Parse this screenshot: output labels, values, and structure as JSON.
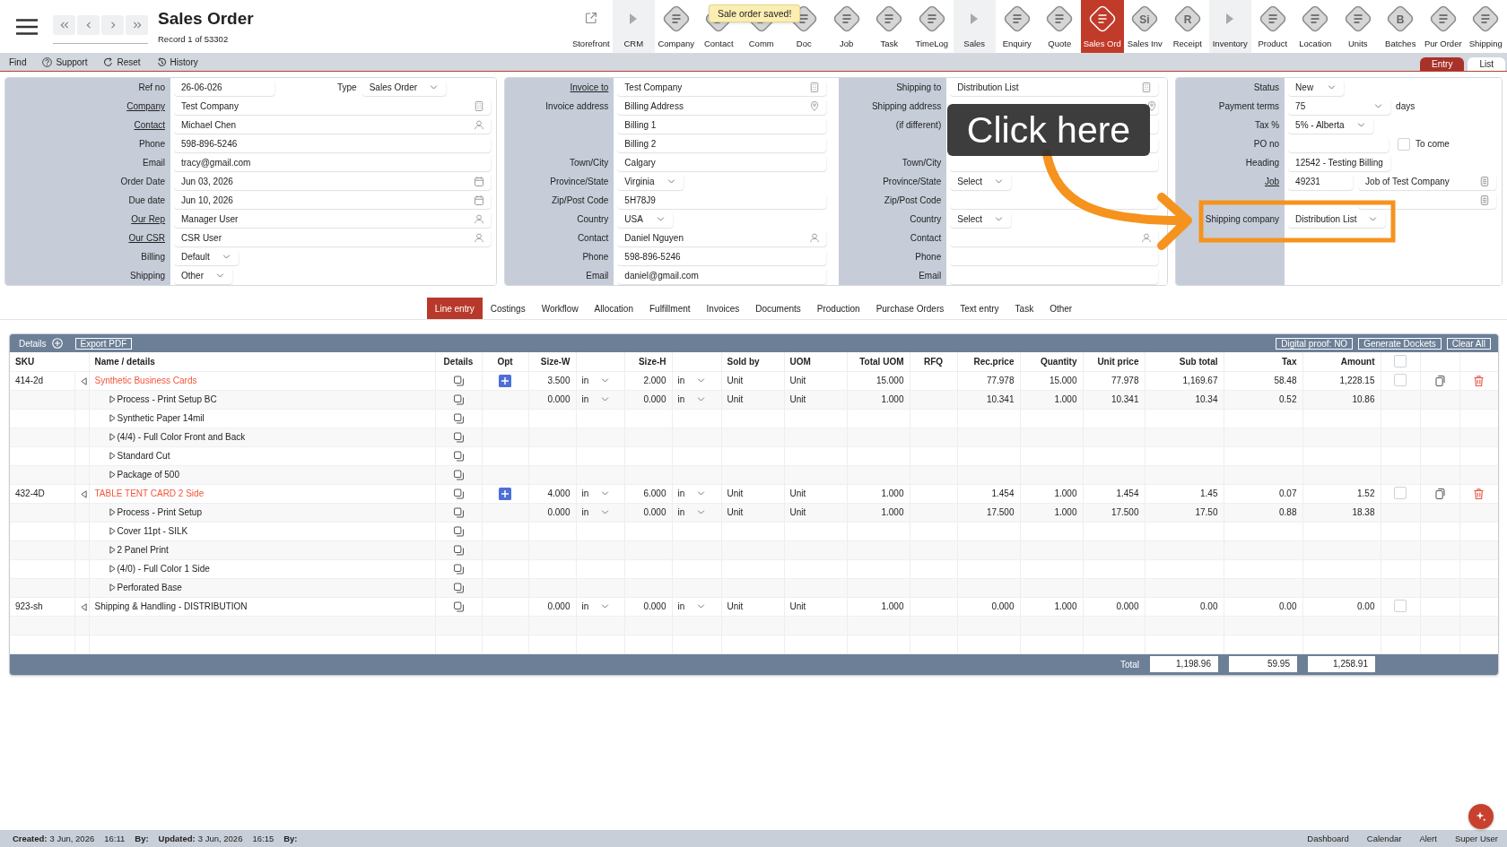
{
  "header": {
    "title": "Sales Order",
    "record": "Record 1 of 53302",
    "toast": "Sale order saved!",
    "toolbar": [
      {
        "label": "Storefront",
        "kind": "link",
        "selected": false
      },
      {
        "label": "CRM",
        "kind": "group",
        "selected": false
      },
      {
        "label": "Company",
        "kind": "module",
        "selected": false
      },
      {
        "label": "Contact",
        "kind": "module",
        "selected": false
      },
      {
        "label": "Comm",
        "kind": "module",
        "selected": false
      },
      {
        "label": "Doc",
        "kind": "module",
        "selected": false
      },
      {
        "label": "Job",
        "kind": "module",
        "selected": false
      },
      {
        "label": "Task",
        "kind": "module",
        "selected": false
      },
      {
        "label": "TimeLog",
        "kind": "module",
        "selected": false
      },
      {
        "label": "Sales",
        "kind": "group",
        "selected": false
      },
      {
        "label": "Enquiry",
        "kind": "module",
        "selected": false
      },
      {
        "label": "Quote",
        "kind": "module",
        "selected": false
      },
      {
        "label": "Sales Ord",
        "kind": "module",
        "selected": true
      },
      {
        "label": "Sales Inv",
        "kind": "module",
        "glyph": "Si",
        "selected": false
      },
      {
        "label": "Receipt",
        "kind": "module",
        "glyph": "R",
        "selected": false
      },
      {
        "label": "Inventory",
        "kind": "group",
        "selected": false
      },
      {
        "label": "Product",
        "kind": "module",
        "selected": false
      },
      {
        "label": "Location",
        "kind": "module",
        "selected": false
      },
      {
        "label": "Units",
        "kind": "module",
        "selected": false
      },
      {
        "label": "Batches",
        "kind": "module",
        "glyph": "B",
        "selected": false
      },
      {
        "label": "Pur Order",
        "kind": "module",
        "selected": false
      },
      {
        "label": "Shipping",
        "kind": "module",
        "selected": false
      }
    ]
  },
  "action_bar": {
    "actions": [
      {
        "label": "Find",
        "kind": "plain"
      },
      {
        "label": "Support",
        "kind": "help"
      },
      {
        "label": "Reset",
        "kind": "reset"
      },
      {
        "label": "History",
        "kind": "history"
      }
    ],
    "view_tabs": [
      {
        "label": "Entry",
        "selected": true
      },
      {
        "label": "List",
        "selected": false
      }
    ]
  },
  "form": {
    "panels": [
      {
        "sections": [
          {
            "rows": [
              {
                "label": "Ref no",
                "link": false,
                "fields": [
                  {
                    "kind": "text",
                    "value": "26-06-026"
                  },
                  {
                    "kind": "caption",
                    "value": "Type"
                  },
                  {
                    "kind": "select",
                    "value": "Sales Order"
                  }
                ]
              },
              {
                "label": "Company",
                "link": true,
                "fields": [
                  {
                    "kind": "company",
                    "value": "Test Company"
                  }
                ]
              },
              {
                "label": "Contact",
                "link": true,
                "fields": [
                  {
                    "kind": "contact",
                    "value": "Michael Chen"
                  }
                ]
              },
              {
                "label": "Phone",
                "link": false,
                "fields": [
                  {
                    "kind": "text",
                    "value": "598-896-5246"
                  }
                ]
              },
              {
                "label": "Email",
                "link": false,
                "fields": [
                  {
                    "kind": "text",
                    "value": "tracy@gmail.com"
                  }
                ]
              },
              {
                "label": "Order Date",
                "link": false,
                "fields": [
                  {
                    "kind": "date",
                    "value": "Jun 03, 2026"
                  }
                ]
              },
              {
                "label": "Due date",
                "link": false,
                "fields": [
                  {
                    "kind": "date",
                    "value": "Jun 10, 2026"
                  }
                ]
              },
              {
                "label": "Our Rep",
                "link": true,
                "fields": [
                  {
                    "kind": "contact",
                    "value": "Manager User"
                  }
                ]
              },
              {
                "label": "Our CSR",
                "link": true,
                "fields": [
                  {
                    "kind": "contact",
                    "value": "CSR User"
                  }
                ]
              },
              {
                "label": "Billing",
                "link": false,
                "fields": [
                  {
                    "kind": "select",
                    "value": "Default"
                  }
                ]
              },
              {
                "label": "Shipping",
                "link": false,
                "fields": [
                  {
                    "kind": "select",
                    "value": "Other"
                  }
                ]
              }
            ]
          }
        ]
      },
      {
        "sections": [
          {
            "rows": [
              {
                "label": "Invoice to",
                "link": true,
                "fields": [
                  {
                    "kind": "company",
                    "value": "Test Company"
                  }
                ]
              },
              {
                "label": "Invoice address",
                "link": false,
                "fields": [
                  {
                    "kind": "address",
                    "value": "Billing Address"
                  }
                ]
              },
              {
                "fields": [
                  {
                    "kind": "text",
                    "value": "Billing 1"
                  }
                ]
              },
              {
                "fields": [
                  {
                    "kind": "text",
                    "value": "Billing 2"
                  }
                ]
              },
              {
                "label": "Town/City",
                "link": false,
                "fields": [
                  {
                    "kind": "text",
                    "value": "Calgary"
                  }
                ]
              },
              {
                "label": "Province/State",
                "link": false,
                "fields": [
                  {
                    "kind": "select",
                    "value": "Virginia"
                  }
                ]
              },
              {
                "label": "Zip/Post Code",
                "link": false,
                "fields": [
                  {
                    "kind": "text",
                    "value": "5H78J9"
                  }
                ]
              },
              {
                "label": "Country",
                "link": false,
                "fields": [
                  {
                    "kind": "select",
                    "value": "USA"
                  }
                ]
              },
              {
                "label": "Contact",
                "link": false,
                "fields": [
                  {
                    "kind": "contact",
                    "value": "Daniel Nguyen"
                  }
                ]
              },
              {
                "label": "Phone",
                "link": false,
                "fields": [
                  {
                    "kind": "text",
                    "value": "598-896-5246"
                  }
                ]
              },
              {
                "label": "Email",
                "link": false,
                "fields": [
                  {
                    "kind": "text",
                    "value": "daniel@gmail.com"
                  }
                ]
              }
            ]
          },
          {
            "rows": [
              {
                "label": "Shipping to",
                "link": false,
                "fields": [
                  {
                    "kind": "company",
                    "value": "Distribution List"
                  }
                ]
              },
              {
                "label": "Shipping address",
                "link": false,
                "fields": [
                  {
                    "kind": "address"
                  }
                ]
              },
              {
                "label": "(if different)",
                "link": false,
                "fields": [
                  {
                    "kind": "text"
                  }
                ]
              },
              {
                "fields": [
                  {
                    "kind": "text"
                  }
                ]
              },
              {
                "label": "Town/City",
                "link": false,
                "fields": [
                  {
                    "kind": "text"
                  }
                ]
              },
              {
                "label": "Province/State",
                "link": false,
                "fields": [
                  {
                    "kind": "select",
                    "value": "Select"
                  }
                ]
              },
              {
                "label": "Zip/Post Code",
                "link": false,
                "fields": [
                  {
                    "kind": "text"
                  }
                ]
              },
              {
                "label": "Country",
                "link": false,
                "fields": [
                  {
                    "kind": "select",
                    "value": "Select"
                  }
                ]
              },
              {
                "label": "Contact",
                "link": false,
                "fields": [
                  {
                    "kind": "contact"
                  }
                ]
              },
              {
                "label": "Phone",
                "link": false,
                "fields": [
                  {
                    "kind": "text"
                  }
                ]
              },
              {
                "label": "Email",
                "link": false,
                "fields": [
                  {
                    "kind": "text"
                  }
                ]
              }
            ]
          }
        ]
      },
      {
        "sections": [
          {
            "rows": [
              {
                "label": "Status",
                "link": false,
                "fields": [
                  {
                    "kind": "select",
                    "value": "New"
                  }
                ]
              },
              {
                "label": "Payment terms",
                "link": false,
                "fields": [
                  {
                    "kind": "select",
                    "value": "75"
                  },
                  {
                    "kind": "caption",
                    "value": "days"
                  }
                ]
              },
              {
                "label": "Tax %",
                "link": false,
                "fields": [
                  {
                    "kind": "select",
                    "value": "5% - Alberta"
                  }
                ]
              },
              {
                "label": "PO no",
                "link": false,
                "fields": [
                  {
                    "kind": "text"
                  },
                  {
                    "kind": "checkbox",
                    "checked": false,
                    "value": "To come"
                  }
                ]
              },
              {
                "label": "Heading",
                "link": false,
                "fields": [
                  {
                    "kind": "text",
                    "value": "12542 - Testing Billing"
                  }
                ]
              },
              {
                "label": "Job",
                "link": true,
                "fields": [
                  {
                    "kind": "text",
                    "value": "49231"
                  },
                  {
                    "kind": "document",
                    "value": "Job of Test Company"
                  }
                ]
              },
              {
                "fields": [
                  {
                    "kind": "document"
                  }
                ]
              },
              {
                "label": "Shipping company",
                "link": false,
                "fields": [
                  {
                    "kind": "select",
                    "value": "Distribution List"
                  }
                ]
              }
            ]
          }
        ]
      }
    ]
  },
  "annotation": {
    "text": "Click here"
  },
  "tabs": [
    {
      "label": "Line entry",
      "selected": true
    },
    {
      "label": "Costings",
      "selected": false
    },
    {
      "label": "Workflow",
      "selected": false
    },
    {
      "label": "Allocation",
      "selected": false
    },
    {
      "label": "Fulfillment",
      "selected": false
    },
    {
      "label": "Invoices",
      "selected": false
    },
    {
      "label": "Documents",
      "selected": false
    },
    {
      "label": "Production",
      "selected": false
    },
    {
      "label": "Purchase Orders",
      "selected": false
    },
    {
      "label": "Text entry",
      "selected": false
    },
    {
      "label": "Task",
      "selected": false
    },
    {
      "label": "Other",
      "selected": false
    }
  ],
  "table": {
    "toolbar": {
      "title": "Details",
      "left_buttons": [
        "Export PDF"
      ],
      "right_buttons": [
        "Digital proof: NO",
        "Generate Dockets",
        "Clear All"
      ]
    },
    "columns": [
      "SKU",
      "Name / details",
      "Details",
      "Opt",
      "Size-W",
      "Size-H",
      "Sold by",
      "UOM",
      "Total UOM",
      "RFQ",
      "Rec.price",
      "Quantity",
      "Unit price",
      "Sub total",
      "Tax",
      "Amount"
    ],
    "select_all": {
      "checked": false
    },
    "rows": [
      {
        "sku": "414-2d",
        "name": "Synthetic Business Cards",
        "options": true,
        "size_w": "3.500",
        "unit_w": "in",
        "size_h": "2.000",
        "unit_h": "in",
        "sold_by": "Unit",
        "uom": "Unit",
        "total_uom": "15.000",
        "rec_price": "77.978",
        "quantity": "15.000",
        "unit_price": "77.978",
        "sub_total": "1,169.67",
        "tax": "58.48",
        "amount": "1,228.15",
        "checked": false,
        "row_actions": true,
        "children": [
          {
            "name": "Process - Print Setup BC",
            "expanded": false,
            "size_w": "0.000",
            "unit_w": "in",
            "size_h": "0.000",
            "unit_h": "in",
            "sold_by": "Unit",
            "uom": "Unit",
            "total_uom": "1.000",
            "rec_price": "10.341",
            "quantity": "1.000",
            "unit_price": "10.341",
            "sub_total": "10.34",
            "tax": "0.52",
            "amount": "10.86"
          },
          {
            "name": "Synthetic Paper 14mil",
            "expanded": false
          },
          {
            "name": "(4/4) - Full Color Front and Back",
            "expanded": false
          },
          {
            "name": "Standard Cut",
            "expanded": false
          },
          {
            "name": "Package of 500",
            "expanded": false
          }
        ]
      },
      {
        "sku": "432-4D",
        "name": "TABLE TENT CARD 2 Side",
        "options": true,
        "size_w": "4.000",
        "unit_w": "in",
        "size_h": "6.000",
        "unit_h": "in",
        "sold_by": "Unit",
        "uom": "Unit",
        "total_uom": "1.000",
        "rec_price": "1.454",
        "quantity": "1.000",
        "unit_price": "1.454",
        "sub_total": "1.45",
        "tax": "0.07",
        "amount": "1.52",
        "checked": false,
        "row_actions": true,
        "children": [
          {
            "name": "Process - Print Setup",
            "expanded": false,
            "size_w": "0.000",
            "unit_w": "in",
            "size_h": "0.000",
            "unit_h": "in",
            "sold_by": "Unit",
            "uom": "Unit",
            "total_uom": "1.000",
            "rec_price": "17.500",
            "quantity": "1.000",
            "unit_price": "17.500",
            "sub_total": "17.50",
            "tax": "0.88",
            "amount": "18.38"
          },
          {
            "name": "Cover 11pt - SILK",
            "expanded": false
          },
          {
            "name": "2 Panel Print",
            "expanded": false
          },
          {
            "name": "(4/0) - Full Color 1 Side",
            "expanded": false
          },
          {
            "name": "Perforated Base",
            "expanded": false
          }
        ]
      },
      {
        "sku": "923-sh",
        "name": "Shipping & Handling - DISTRIBUTION",
        "options": false,
        "size_w": "0.000",
        "unit_w": "in",
        "size_h": "0.000",
        "unit_h": "in",
        "sold_by": "Unit",
        "uom": "Unit",
        "total_uom": "1.000",
        "rec_price": "0.000",
        "quantity": "1.000",
        "unit_price": "0.000",
        "sub_total": "0.00",
        "tax": "0.00",
        "amount": "0.00",
        "checked": false,
        "row_actions": false
      }
    ],
    "totals": {
      "label": "Total",
      "sub_total": "1,198.96",
      "tax": "59.95",
      "amount": "1,258.91"
    }
  },
  "status_bar": {
    "entries": [
      {
        "label": "Created:",
        "value": "3 Jun, 2026"
      },
      {
        "value": "16:11"
      },
      {
        "label": "By:"
      },
      {
        "label": "Updated:",
        "value": "3 Jun, 2026"
      },
      {
        "value": "16:15"
      },
      {
        "label": "By:"
      }
    ],
    "links": [
      "Dashboard",
      "Calendar",
      "Alert",
      "Super User"
    ]
  }
}
